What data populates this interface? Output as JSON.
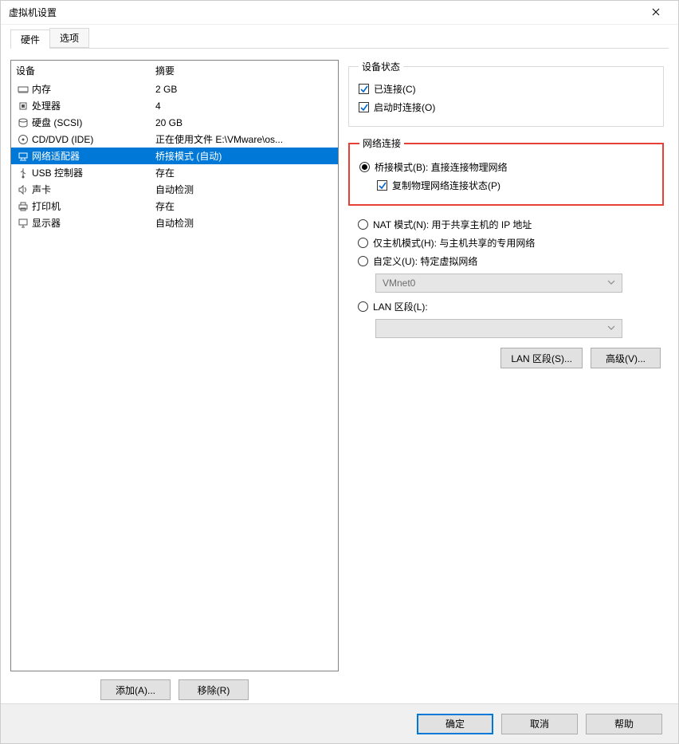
{
  "window": {
    "title": "虚拟机设置"
  },
  "tabs": {
    "hardware": "硬件",
    "options": "选项"
  },
  "device_table": {
    "header_device": "设备",
    "header_summary": "摘要"
  },
  "devices": [
    {
      "icon": "memory-icon",
      "name": "内存",
      "summary": "2 GB"
    },
    {
      "icon": "cpu-icon",
      "name": "处理器",
      "summary": "4"
    },
    {
      "icon": "disk-icon",
      "name": "硬盘 (SCSI)",
      "summary": "20 GB"
    },
    {
      "icon": "disc-icon",
      "name": "CD/DVD (IDE)",
      "summary": "正在使用文件 E:\\VMware\\os..."
    },
    {
      "icon": "network-icon",
      "name": "网络适配器",
      "summary": "桥接模式 (自动)"
    },
    {
      "icon": "usb-icon",
      "name": "USB 控制器",
      "summary": "存在"
    },
    {
      "icon": "sound-icon",
      "name": "声卡",
      "summary": "自动检测"
    },
    {
      "icon": "printer-icon",
      "name": "打印机",
      "summary": "存在"
    },
    {
      "icon": "display-icon",
      "name": "显示器",
      "summary": "自动检测"
    }
  ],
  "selected_device_index": 4,
  "left_buttons": {
    "add": "添加(A)...",
    "remove": "移除(R)"
  },
  "status_group": {
    "legend": "设备状态",
    "connected": "已连接(C)",
    "connect_at_power_on": "启动时连接(O)"
  },
  "network_group": {
    "legend": "网络连接",
    "bridged": "桥接模式(B): 直接连接物理网络",
    "replicate": "复制物理网络连接状态(P)",
    "nat": "NAT 模式(N): 用于共享主机的 IP 地址",
    "hostonly": "仅主机模式(H): 与主机共享的专用网络",
    "custom": "自定义(U): 特定虚拟网络",
    "custom_net": "VMnet0",
    "lan_segment": "LAN 区段(L):",
    "lan_segment_value": ""
  },
  "right_buttons": {
    "lan_segments": "LAN 区段(S)...",
    "advanced": "高级(V)..."
  },
  "footer": {
    "ok": "确定",
    "cancel": "取消",
    "help": "帮助"
  }
}
